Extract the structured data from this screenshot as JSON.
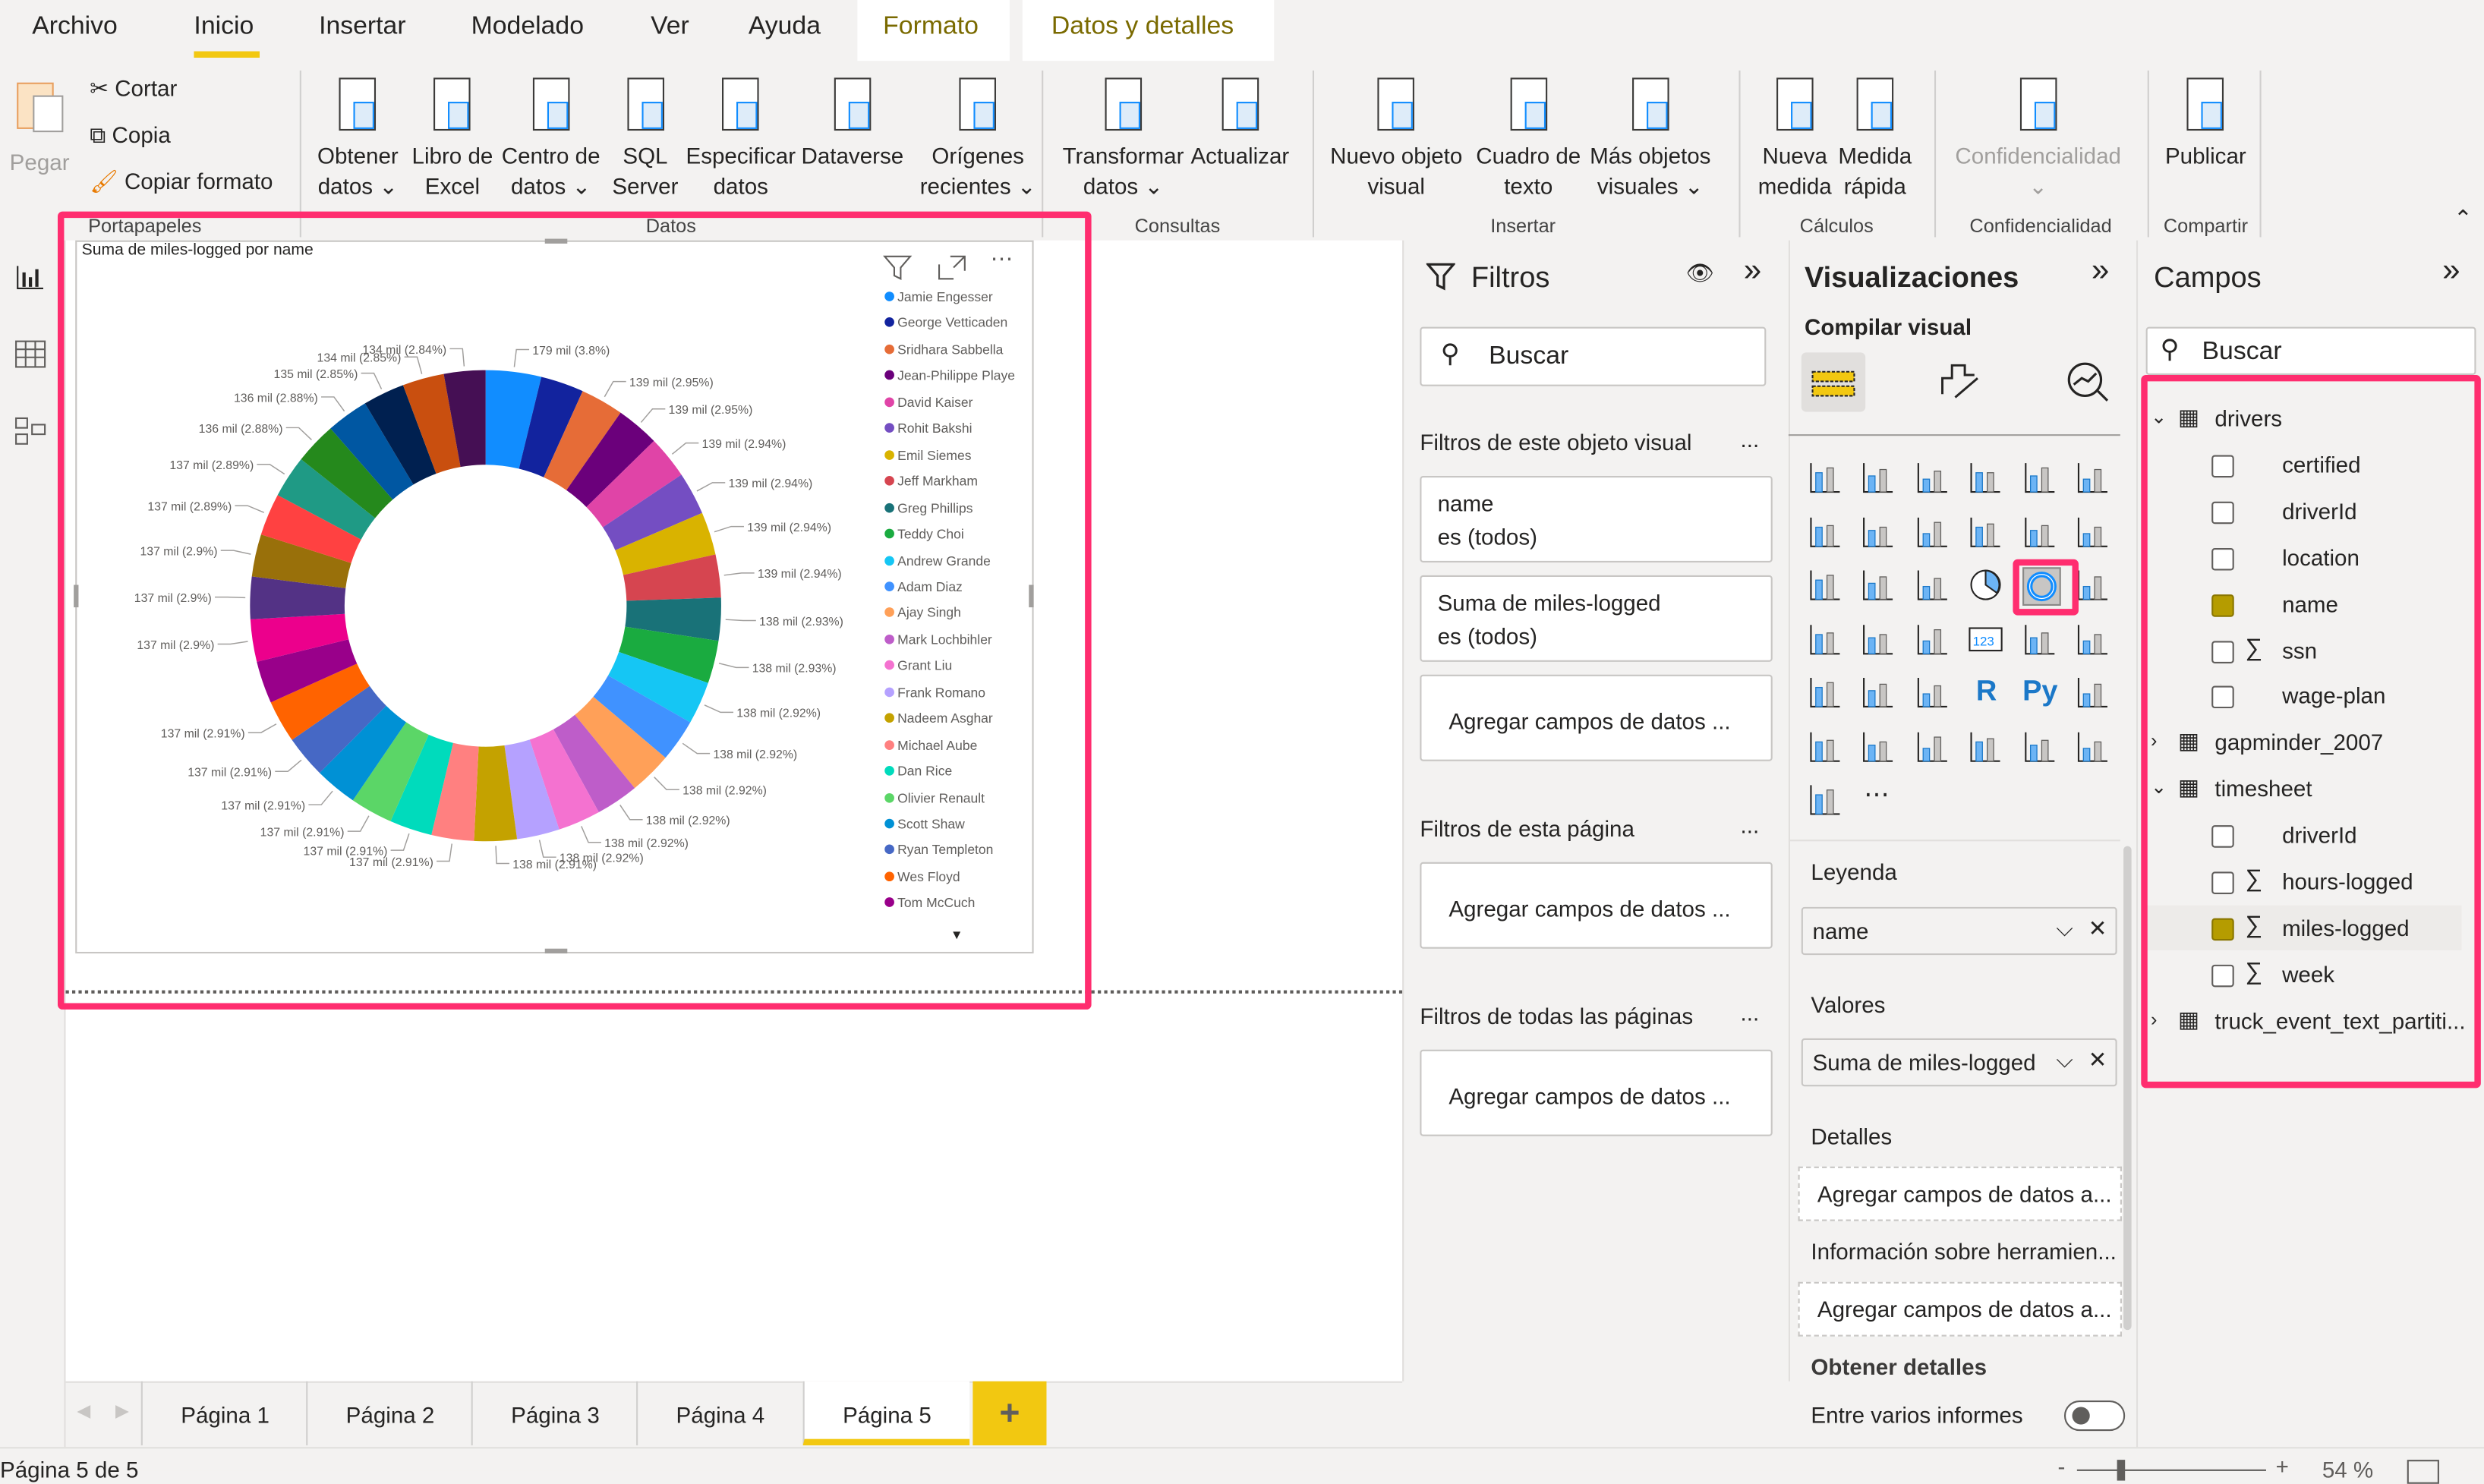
{
  "menu_tabs": [
    "Archivo",
    "Inicio",
    "Insertar",
    "Modelado",
    "Ver",
    "Ayuda",
    "Formato",
    "Datos y detalles"
  ],
  "active_tab": "Inicio",
  "accent_color": "#F2C811",
  "highlight_color": "#FF2D6F",
  "ribbon": {
    "clipboard": {
      "paste": "Pegar",
      "cut": "Cortar",
      "copy": "Copia",
      "format_painter": "Copiar formato",
      "group": "Portapapeles"
    },
    "data": {
      "items": [
        [
          "Obtener",
          "datos ⌄"
        ],
        [
          "Libro de",
          "Excel"
        ],
        [
          "Centro de",
          "datos ⌄"
        ],
        [
          "SQL",
          "Server"
        ],
        [
          "Especificar",
          "datos"
        ],
        [
          "Dataverse",
          ""
        ],
        [
          "Orígenes",
          "recientes ⌄"
        ]
      ],
      "group": "Datos"
    },
    "queries": {
      "items": [
        [
          "Transformar",
          "datos ⌄"
        ],
        [
          "Actualizar",
          ""
        ]
      ],
      "group": "Consultas"
    },
    "insert": {
      "items": [
        [
          "Nuevo objeto",
          "visual"
        ],
        [
          "Cuadro de",
          "texto"
        ],
        [
          "Más objetos",
          "visuales ⌄"
        ]
      ],
      "group": "Insertar"
    },
    "calc": {
      "items": [
        [
          "Nueva",
          "medida"
        ],
        [
          "Medida",
          "rápida"
        ]
      ],
      "group": "Cálculos"
    },
    "sensitivity": {
      "items": [
        [
          "Confidencialidad",
          "⌄"
        ]
      ],
      "group": "Confidencialidad"
    },
    "share": {
      "items": [
        [
          "Publicar",
          ""
        ]
      ],
      "group": "Compartir"
    }
  },
  "visual": {
    "title": "Suma de miles-logged por name"
  },
  "chart_data": {
    "type": "donut",
    "title": "Suma de miles-logged por name",
    "legend_position": "right",
    "legend": [
      "Jamie Engesser",
      "George Vetticaden",
      "Sridhara Sabbella",
      "Jean-Philippe Playe",
      "David Kaiser",
      "Rohit Bakshi",
      "Emil Siemes",
      "Jeff Markham",
      "Greg Phillips",
      "Teddy Choi",
      "Andrew Grande",
      "Adam Diaz",
      "Ajay Singh",
      "Mark Lochbihler",
      "Grant Liu",
      "Frank Romano",
      "Nadeem Asghar",
      "Michael Aube",
      "Dan Rice",
      "Olivier Renault",
      "Scott Shaw",
      "Ryan Templeton",
      "Wes Floyd",
      "Tom McCuch"
    ],
    "unit": "mil",
    "values": [
      179,
      139,
      139,
      139,
      139,
      139,
      139,
      139,
      138,
      138,
      138,
      138,
      138,
      138,
      138,
      138,
      138,
      137,
      137,
      137,
      137,
      137,
      137,
      137,
      137,
      137,
      137,
      137,
      137,
      136,
      136,
      135,
      134,
      134
    ],
    "percents": [
      3.8,
      2.95,
      2.95,
      2.95,
      2.94,
      2.94,
      2.94,
      2.94,
      2.93,
      2.93,
      2.92,
      2.92,
      2.92,
      2.92,
      2.92,
      2.92,
      2.91,
      2.91,
      2.91,
      2.91,
      2.91,
      2.91,
      2.91,
      2.9,
      2.9,
      2.9,
      2.9,
      2.89,
      2.89,
      2.88,
      2.88,
      2.85,
      2.85,
      2.84
    ],
    "labels": [
      "179 mil (3.8%)",
      null,
      "139 mil (2.95%)",
      "139 mil (2.95%)",
      "139 mil (2.94%)",
      "139 mil (2.94%)",
      "139 mil (2.94%)",
      "139 mil (2.94%)",
      "138 mil (2.93%)",
      "138 mil (2.93%)",
      "138 mil (2.92%)",
      "138 mil (2.92%)",
      "138 mil (2.92%)",
      "138 mil (2.92%)",
      "138 mil (2.92%)",
      "138 mil (2.92%)",
      "138 mil (2.91%)",
      "137 mil (2.91%)",
      "137 mil (2.91%)",
      "137 mil (2.91%)",
      "137 mil (2.91%)",
      "137 mil (2.91%)",
      "137 mil (2.91%)",
      null,
      "137 mil (2.9%)",
      "137 mil (2.9%)",
      "137 mil (2.9%)",
      "137 mil (2.89%)",
      "137 mil (2.89%)",
      "136 mil (2.88%)",
      "136 mil (2.88%)",
      "135 mil (2.85%)",
      "134 mil (2.85%)",
      "134 mil (2.84%)"
    ],
    "colors": [
      "#118DFF",
      "#12239E",
      "#E66C37",
      "#6B007B",
      "#E044A7",
      "#744EC2",
      "#D9B300",
      "#D64550",
      "#197278",
      "#1AAB40",
      "#15C6F4",
      "#4092FF",
      "#FFA058",
      "#BE5DC9",
      "#F472D0",
      "#B5A1FF",
      "#C4A200",
      "#FF8080",
      "#00DBBC",
      "#5BD667",
      "#0091D5",
      "#4668C5",
      "#FF6300",
      "#99008A",
      "#EC008C",
      "#533285",
      "#99700A",
      "#FF4141",
      "#1F9A85",
      "#25891C",
      "#0057A2",
      "#002050",
      "#C94F0F",
      "#450F54"
    ]
  },
  "filters": {
    "title": "Filtros",
    "search_placeholder": "Buscar",
    "this_visual": "Filtros de este objeto visual",
    "cards": [
      {
        "field": "name",
        "state": "es (todos)"
      },
      {
        "field": "Suma de miles-logged",
        "state": "es (todos)"
      }
    ],
    "add_fields": "Agregar campos de datos ...",
    "this_page": "Filtros de esta página",
    "all_pages": "Filtros de todas las páginas",
    "more": "..."
  },
  "visualizations": {
    "title": "Visualizaciones",
    "subtitle": "Compilar visual",
    "gallery": [
      "stacked-bar",
      "stacked-column",
      "clustered-bar",
      "clustered-column",
      "100-bar",
      "100-column",
      "line",
      "area",
      "stacked-area",
      "line-column",
      "line-clustered-column",
      "ribbon",
      "waterfall",
      "funnel",
      "scatter",
      "pie",
      "donut",
      "treemap",
      "map",
      "filled-map",
      "gauge",
      "card",
      "multi-row-card",
      "kpi",
      "slicer",
      "table",
      "matrix",
      "r-visual",
      "python-visual",
      "key-influencers",
      "decomposition-tree",
      "qa",
      "smart-narrative",
      "paginated-report",
      "azure-map",
      "power-apps",
      "power-automate",
      "more"
    ],
    "selected": "donut",
    "wells": [
      {
        "label": "Leyenda",
        "value": "name"
      },
      {
        "label": "Valores",
        "value": "Suma de miles-logged"
      },
      {
        "label": "Detalles",
        "placeholder": "Agregar campos de datos a..."
      },
      {
        "label": "Información sobre herramien...",
        "placeholder": "Agregar campos de datos a..."
      }
    ],
    "drill": "Obtener detalles",
    "cross_report": "Entre varios informes",
    "cross_report_on": false
  },
  "fields": {
    "title": "Campos",
    "search_placeholder": "Buscar",
    "tables": [
      {
        "name": "drivers",
        "expanded": true,
        "fields": [
          {
            "name": "certified",
            "checked": false,
            "sum": false
          },
          {
            "name": "driverId",
            "checked": false,
            "sum": false
          },
          {
            "name": "location",
            "checked": false,
            "sum": false
          },
          {
            "name": "name",
            "checked": true,
            "sum": false
          },
          {
            "name": "ssn",
            "checked": false,
            "sum": true
          },
          {
            "name": "wage-plan",
            "checked": false,
            "sum": false
          }
        ]
      },
      {
        "name": "gapminder_2007",
        "expanded": false,
        "fields": []
      },
      {
        "name": "timesheet",
        "expanded": true,
        "fields": [
          {
            "name": "driverId",
            "checked": false,
            "sum": false
          },
          {
            "name": "hours-logged",
            "checked": false,
            "sum": true
          },
          {
            "name": "miles-logged",
            "checked": true,
            "sum": true
          },
          {
            "name": "week",
            "checked": false,
            "sum": true
          }
        ]
      },
      {
        "name": "truck_event_text_partiti...",
        "expanded": false,
        "fields": []
      }
    ]
  },
  "pages": [
    "Página 1",
    "Página 2",
    "Página 3",
    "Página 4",
    "Página 5"
  ],
  "active_page": "Página 5",
  "add_page": "+",
  "status": {
    "page_info": "Página 5 de 5",
    "zoom": "54 %",
    "zoom_level": 54,
    "minus": "-",
    "plus": "+"
  }
}
